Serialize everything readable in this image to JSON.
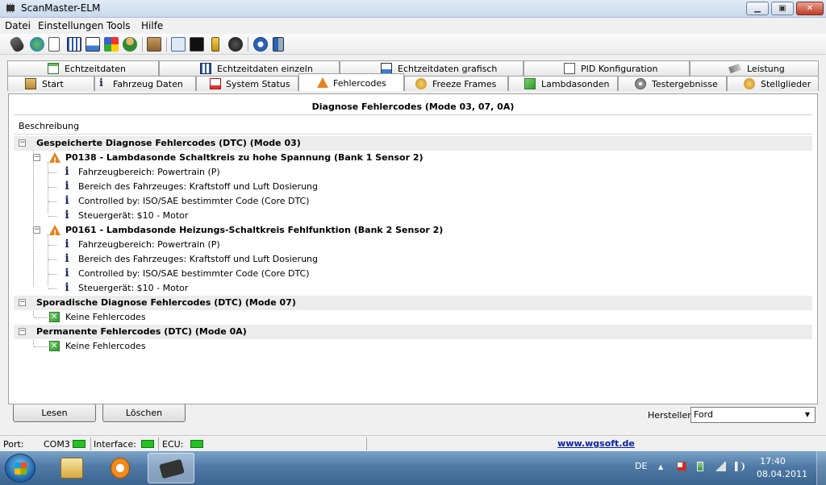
{
  "window": {
    "title": "ScanMaster-ELM",
    "min_glyph": "▁",
    "max_glyph": "▣",
    "close_glyph": "✕"
  },
  "menu": [
    "Datei",
    "Einstellungen",
    "Tools",
    "Hilfe"
  ],
  "toolbar_icons": [
    "connect-icon",
    "globe-icon",
    "document-icon",
    "grid-icon",
    "chart-icon",
    "puzzle-icon",
    "people-icon",
    "clipboard-icon",
    "monitor-icon",
    "terminal-icon",
    "battery-icon",
    "gauge-icon",
    "info-icon",
    "exit-icon"
  ],
  "tabs_row1": [
    "Echtzeitdaten",
    "Echtzeitdaten einzeln",
    "Echtzeitdaten grafisch",
    "PID Konfiguration",
    "Leistung"
  ],
  "tabs_row2": [
    "Start",
    "Fahrzeug Daten",
    "System Status",
    "Fehlercodes",
    "Freeze Frames",
    "Lambdasonden",
    "Testergebnisse",
    "Stellglieder"
  ],
  "panel": {
    "title": "Diagnose Fehlercodes (Mode 03, 07, 0A)",
    "column": "Beschreibung",
    "expanded_glyph": "−",
    "groups": [
      {
        "label": "Gespeicherte Diagnose Fehlercodes (DTC) (Mode 03)",
        "codes": [
          {
            "label": "P0138 - Lambdasonde Schaltkreis zu hohe Spannung (Bank 1 Sensor 2)",
            "details": [
              "Fahrzeugbereich: Powertrain (P)",
              "Bereich des Fahrzeuges: Kraftstoff und Luft Dosierung",
              "Controlled by: ISO/SAE bestimmter Code (Core DTC)",
              "Steuergerät: $10 - Motor"
            ]
          },
          {
            "label": "P0161 - Lambdasonde Heizungs-Schaltkreis Fehlfunktion (Bank 2 Sensor 2)",
            "details": [
              "Fahrzeugbereich: Powertrain (P)",
              "Bereich des Fahrzeuges: Kraftstoff und Luft Dosierung",
              "Controlled by: ISO/SAE bestimmter Code (Core DTC)",
              "Steuergerät: $10 - Motor"
            ]
          }
        ]
      },
      {
        "label": "Sporadische Diagnose Fehlercodes (DTC) (Mode 07)",
        "none": "Keine Fehlercodes"
      },
      {
        "label": "Permanente Fehlercodes (DTC) (Mode 0A)",
        "none": "Keine Fehlercodes"
      }
    ]
  },
  "buttons": {
    "read": "Lesen",
    "delete": "Löschen"
  },
  "manufacturer": {
    "label": "Hersteller",
    "value": "Ford",
    "arrow": "▼"
  },
  "status": {
    "port_label": "Port:",
    "port_value": "COM3",
    "interface_label": "Interface:",
    "ecu_label": "ECU:",
    "website": "www.wgsoft.de",
    "led_color": "#21c321"
  },
  "taskbar": {
    "lang": "DE",
    "tray_arrow": "▲",
    "time": "17:40",
    "date": "08.04.2011"
  }
}
